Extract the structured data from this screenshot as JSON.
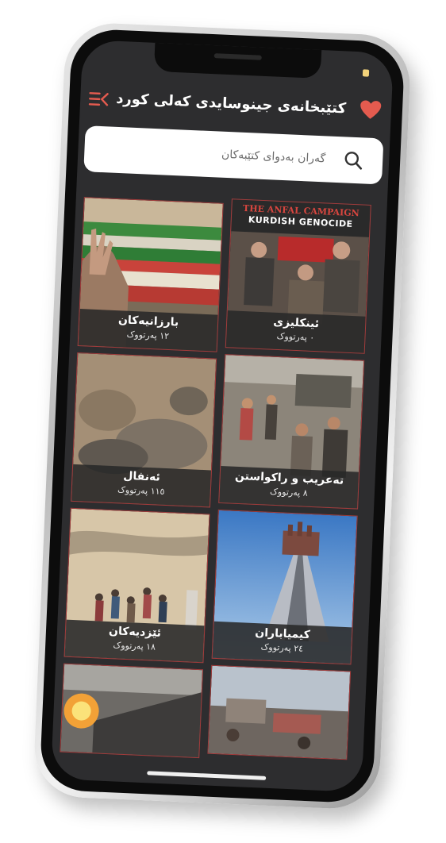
{
  "header": {
    "title": "کتێبخانەی جینوسایدی کەلی کورد",
    "menu_icon": "menu-arrow-icon",
    "heart_icon": "heart-icon",
    "accent": "#e45b4f"
  },
  "search": {
    "placeholder": "گەران بەدوای کتێبەکان",
    "icon": "search-icon"
  },
  "categories": [
    {
      "title": "بارزانیەکان",
      "count": "١٢ پەرتووک"
    },
    {
      "title": "ئینکلیزی",
      "count": "٠ پەرتووک"
    },
    {
      "title": "ئەنفال",
      "count": "١١٥ پەرتووک"
    },
    {
      "title": "تەعریب و راکواستن",
      "count": "٨ پەرتووک"
    },
    {
      "title": "ئێزدیەکان",
      "count": "١٨ پەرتووک"
    },
    {
      "title": "کیمیاباران",
      "count": "٢٤ پەرتووک"
    }
  ],
  "poster_text": {
    "line1": "THE ANFAL CAMPAIGN",
    "line2": "KURDISH GENOCIDE"
  },
  "colors": {
    "screen_bg": "#2d2d2f",
    "card_border": "#a33b3b",
    "search_bg": "#ffffff"
  }
}
